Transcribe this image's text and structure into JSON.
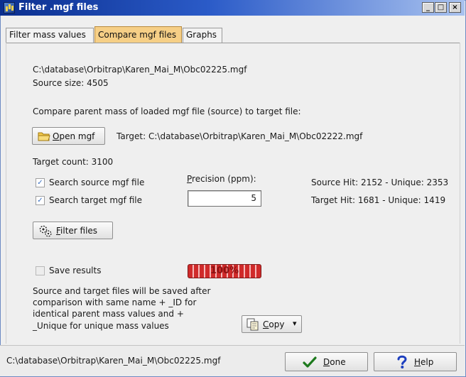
{
  "window": {
    "title": "Filter .mgf files",
    "caption_buttons": {
      "minimize": "_",
      "maximize": "□",
      "close": "×"
    }
  },
  "tabs": [
    {
      "label": "Filter mass values",
      "active": false
    },
    {
      "label": "Compare mgf files",
      "active": true
    },
    {
      "label": "Graphs",
      "active": false
    }
  ],
  "source": {
    "path": "C:\\database\\Orbitrap\\Karen_Mai_M\\Obc02225.mgf",
    "size_text": "Source size: 4505"
  },
  "compare_instruction": "Compare parent mass of loaded mgf file (source) to target file:",
  "open_button": {
    "prefix": "O",
    "rest": "pen mgf",
    "icon": "folder-icon"
  },
  "target": {
    "label": "Target: C:\\database\\Orbitrap\\Karen_Mai_M\\Obc02222.mgf",
    "count_text": "Target count: 3100"
  },
  "options": {
    "search_source": {
      "label": "Search source mgf file",
      "checked": true
    },
    "search_target": {
      "label": "Search target mgf file",
      "checked": true
    },
    "check_mark": "✓"
  },
  "precision": {
    "label_prefix": "P",
    "label_rest": "recision (ppm):",
    "value": "5"
  },
  "hits": {
    "source": "Source Hit: 2152 - Unique: 2353",
    "target": "Target Hit: 1681 - Unique: 1419"
  },
  "filter_button": {
    "prefix": "F",
    "rest": "ilter files",
    "icon": "gears-icon"
  },
  "save_results": {
    "label": "Save results",
    "checked": false,
    "enabled": false
  },
  "progress": {
    "percent": 100,
    "text": "100%",
    "color": "#d02a2a"
  },
  "save_description": [
    "Source and target files will be saved  after",
    "comparison with same name + _ID for",
    "identical parent mass values and +",
    "_Unique for unique mass values"
  ],
  "copy_button": {
    "prefix": "C",
    "rest": "opy",
    "icon": "copy-icon",
    "dropdown": "▾"
  },
  "status_bar": {
    "path": "C:\\database\\Orbitrap\\Karen_Mai_M\\Obc02225.mgf"
  },
  "done_button": {
    "prefix": "D",
    "rest": "one",
    "icon": "checkmark-icon",
    "icon_color": "#1e7a1e"
  },
  "help_button": {
    "prefix": "H",
    "rest": "elp",
    "icon": "question-icon",
    "icon_color": "#1d3fbf"
  }
}
